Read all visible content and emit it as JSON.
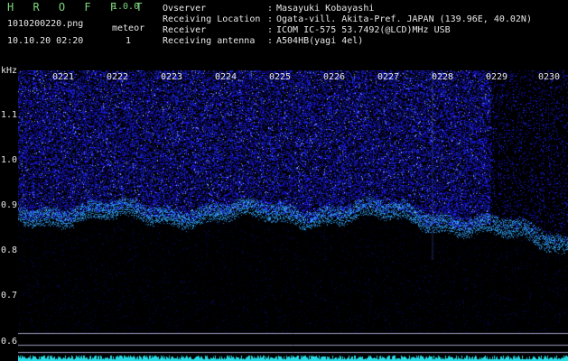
{
  "header": {
    "app_title": "H R O F F T",
    "app_version": "1.0.0",
    "filename": "1010200220.png",
    "datetime": "10.10.20 02:20",
    "count_label": "meteor",
    "count_value": "1"
  },
  "info": [
    {
      "label": "Ovserver",
      "value": "Masayuki Kobayashi"
    },
    {
      "label": "Receiving Location",
      "value": "Ogata-vill. Akita-Pref. JAPAN (139.96E, 40.02N)"
    },
    {
      "label": "Receiver",
      "value": "ICOM IC-575 53.7492(@LCD)MHz USB"
    },
    {
      "label": "Receiving antenna",
      "value": "A504HB(yagi 4el)"
    }
  ],
  "info_separator": ":",
  "spectrogram": {
    "y_unit": "kHz",
    "y_ticks": [
      "1.1",
      "1.0",
      "0.9",
      "0.8",
      "0.7",
      "0.6"
    ],
    "x_ticks": [
      "0221",
      "0222",
      "0223",
      "0224",
      "0225",
      "0226",
      "0227",
      "0228",
      "0229",
      "0230"
    ],
    "colors": {
      "background": "#000000",
      "noise": "#2232c8",
      "signal": "#4fb4ff",
      "baseline": "#2fe6f2",
      "marker": "#9a9ac0"
    }
  }
}
